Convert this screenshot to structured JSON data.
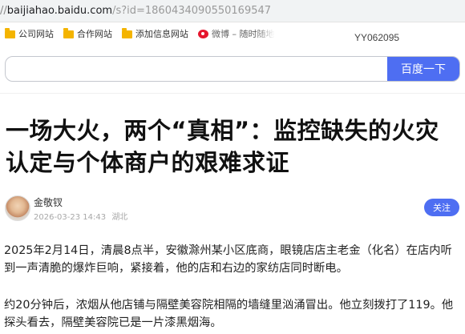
{
  "browser": {
    "url_scheme": "//",
    "url_host": "baijiahao.baidu.com",
    "url_path": "/s?id=1860434090550169547",
    "bookmarks": [
      {
        "label": "公司网站",
        "icon": "folder-icon"
      },
      {
        "label": "合作网站",
        "icon": "folder-icon"
      },
      {
        "label": "添加信息网站",
        "icon": "folder-icon"
      },
      {
        "label": "微博 – 随时随地",
        "icon": "weibo-icon"
      }
    ],
    "watermark": "YY062095"
  },
  "search": {
    "value": "",
    "button_label": "百度一下"
  },
  "article": {
    "title": "一场大火，两个“真相”：监控缺失的火灾认定与个体商户的艰难求证",
    "author": {
      "name": "金敬钗",
      "date": "2026-03-23 14:43",
      "location": "湖北",
      "follow_label": "关注"
    },
    "paragraphs": [
      "2025年2月14日，清晨8点半，安徽滁州某小区底商，眼镜店店主老金（化名）在店内听到一声清脆的爆炸巨响，紧接着，他的店和右边的家纺店同时断电。",
      "约20分钟后，浓烟从他店铺与隔壁美容院相隔的墙缝里汹涌冒出。他立刻拨打了119。他探头看去，隔壁美容院已是一片漆黑烟海。"
    ]
  },
  "colors": {
    "accent": "#4e6ef2",
    "folder": "#f4b400",
    "weibo": "#e6162d"
  }
}
